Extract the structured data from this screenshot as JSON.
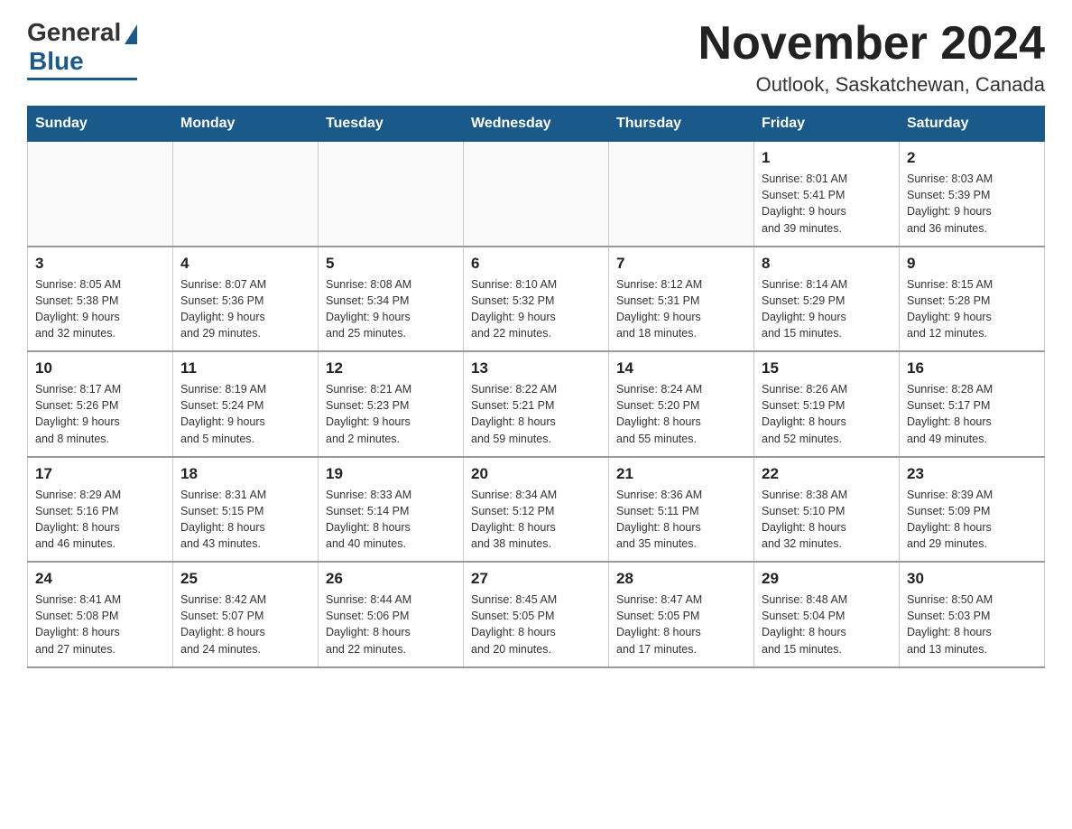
{
  "logo": {
    "general": "General",
    "blue": "Blue"
  },
  "header": {
    "month_year": "November 2024",
    "location": "Outlook, Saskatchewan, Canada"
  },
  "days_of_week": [
    "Sunday",
    "Monday",
    "Tuesday",
    "Wednesday",
    "Thursday",
    "Friday",
    "Saturday"
  ],
  "weeks": [
    [
      {
        "day": "",
        "info": ""
      },
      {
        "day": "",
        "info": ""
      },
      {
        "day": "",
        "info": ""
      },
      {
        "day": "",
        "info": ""
      },
      {
        "day": "",
        "info": ""
      },
      {
        "day": "1",
        "info": "Sunrise: 8:01 AM\nSunset: 5:41 PM\nDaylight: 9 hours\nand 39 minutes."
      },
      {
        "day": "2",
        "info": "Sunrise: 8:03 AM\nSunset: 5:39 PM\nDaylight: 9 hours\nand 36 minutes."
      }
    ],
    [
      {
        "day": "3",
        "info": "Sunrise: 8:05 AM\nSunset: 5:38 PM\nDaylight: 9 hours\nand 32 minutes."
      },
      {
        "day": "4",
        "info": "Sunrise: 8:07 AM\nSunset: 5:36 PM\nDaylight: 9 hours\nand 29 minutes."
      },
      {
        "day": "5",
        "info": "Sunrise: 8:08 AM\nSunset: 5:34 PM\nDaylight: 9 hours\nand 25 minutes."
      },
      {
        "day": "6",
        "info": "Sunrise: 8:10 AM\nSunset: 5:32 PM\nDaylight: 9 hours\nand 22 minutes."
      },
      {
        "day": "7",
        "info": "Sunrise: 8:12 AM\nSunset: 5:31 PM\nDaylight: 9 hours\nand 18 minutes."
      },
      {
        "day": "8",
        "info": "Sunrise: 8:14 AM\nSunset: 5:29 PM\nDaylight: 9 hours\nand 15 minutes."
      },
      {
        "day": "9",
        "info": "Sunrise: 8:15 AM\nSunset: 5:28 PM\nDaylight: 9 hours\nand 12 minutes."
      }
    ],
    [
      {
        "day": "10",
        "info": "Sunrise: 8:17 AM\nSunset: 5:26 PM\nDaylight: 9 hours\nand 8 minutes."
      },
      {
        "day": "11",
        "info": "Sunrise: 8:19 AM\nSunset: 5:24 PM\nDaylight: 9 hours\nand 5 minutes."
      },
      {
        "day": "12",
        "info": "Sunrise: 8:21 AM\nSunset: 5:23 PM\nDaylight: 9 hours\nand 2 minutes."
      },
      {
        "day": "13",
        "info": "Sunrise: 8:22 AM\nSunset: 5:21 PM\nDaylight: 8 hours\nand 59 minutes."
      },
      {
        "day": "14",
        "info": "Sunrise: 8:24 AM\nSunset: 5:20 PM\nDaylight: 8 hours\nand 55 minutes."
      },
      {
        "day": "15",
        "info": "Sunrise: 8:26 AM\nSunset: 5:19 PM\nDaylight: 8 hours\nand 52 minutes."
      },
      {
        "day": "16",
        "info": "Sunrise: 8:28 AM\nSunset: 5:17 PM\nDaylight: 8 hours\nand 49 minutes."
      }
    ],
    [
      {
        "day": "17",
        "info": "Sunrise: 8:29 AM\nSunset: 5:16 PM\nDaylight: 8 hours\nand 46 minutes."
      },
      {
        "day": "18",
        "info": "Sunrise: 8:31 AM\nSunset: 5:15 PM\nDaylight: 8 hours\nand 43 minutes."
      },
      {
        "day": "19",
        "info": "Sunrise: 8:33 AM\nSunset: 5:14 PM\nDaylight: 8 hours\nand 40 minutes."
      },
      {
        "day": "20",
        "info": "Sunrise: 8:34 AM\nSunset: 5:12 PM\nDaylight: 8 hours\nand 38 minutes."
      },
      {
        "day": "21",
        "info": "Sunrise: 8:36 AM\nSunset: 5:11 PM\nDaylight: 8 hours\nand 35 minutes."
      },
      {
        "day": "22",
        "info": "Sunrise: 8:38 AM\nSunset: 5:10 PM\nDaylight: 8 hours\nand 32 minutes."
      },
      {
        "day": "23",
        "info": "Sunrise: 8:39 AM\nSunset: 5:09 PM\nDaylight: 8 hours\nand 29 minutes."
      }
    ],
    [
      {
        "day": "24",
        "info": "Sunrise: 8:41 AM\nSunset: 5:08 PM\nDaylight: 8 hours\nand 27 minutes."
      },
      {
        "day": "25",
        "info": "Sunrise: 8:42 AM\nSunset: 5:07 PM\nDaylight: 8 hours\nand 24 minutes."
      },
      {
        "day": "26",
        "info": "Sunrise: 8:44 AM\nSunset: 5:06 PM\nDaylight: 8 hours\nand 22 minutes."
      },
      {
        "day": "27",
        "info": "Sunrise: 8:45 AM\nSunset: 5:05 PM\nDaylight: 8 hours\nand 20 minutes."
      },
      {
        "day": "28",
        "info": "Sunrise: 8:47 AM\nSunset: 5:05 PM\nDaylight: 8 hours\nand 17 minutes."
      },
      {
        "day": "29",
        "info": "Sunrise: 8:48 AM\nSunset: 5:04 PM\nDaylight: 8 hours\nand 15 minutes."
      },
      {
        "day": "30",
        "info": "Sunrise: 8:50 AM\nSunset: 5:03 PM\nDaylight: 8 hours\nand 13 minutes."
      }
    ]
  ]
}
